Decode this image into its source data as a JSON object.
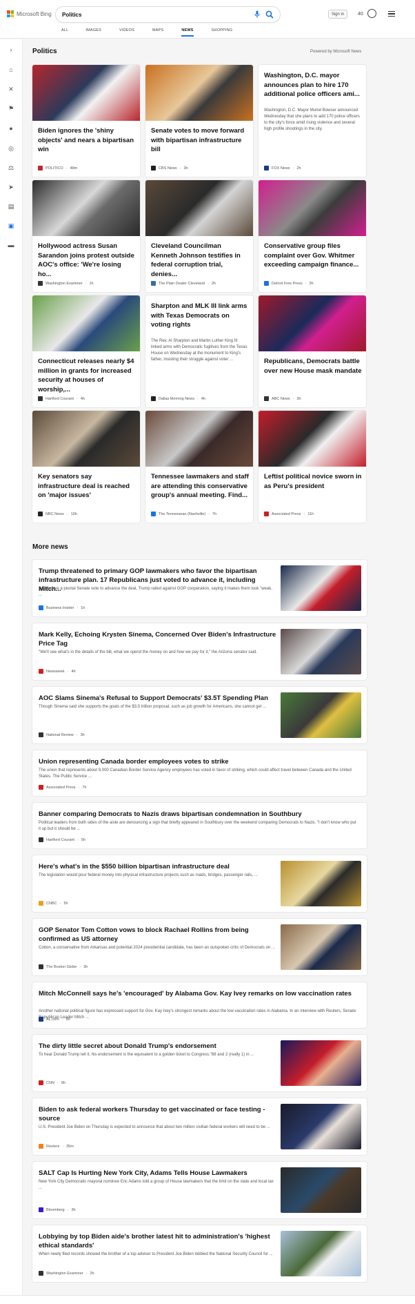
{
  "header": {
    "logo_text": "Microsoft Bing",
    "search_value": "Politics",
    "signin_label": "Sign in",
    "points": "40",
    "tabs": [
      "ALL",
      "IMAGES",
      "VIDEOS",
      "MAPS",
      "NEWS",
      "SHOPPING"
    ],
    "active_tab": "NEWS"
  },
  "rail_icons": [
    "chevron-right-icon",
    "home-icon",
    "tools-icon",
    "flag-icon",
    "location-icon",
    "globe-icon",
    "scales-icon",
    "rocket-icon",
    "film-icon",
    "bank-icon",
    "wallet-icon"
  ],
  "politics": {
    "title": "Politics",
    "powered_by": "Powered by Microsoft News",
    "cards": [
      {
        "title": "Biden ignores the 'shiny objects' and nears a bipartisan win",
        "source": "POLITICO",
        "time": "48m",
        "fav_color": "#c4262e",
        "img": [
          "#b7262d",
          "#f2f2f2",
          "#2c3a5a"
        ]
      },
      {
        "title": "Senate votes to move forward with bipartisan infrastructure bill",
        "source": "CBS News",
        "time": "3h",
        "fav_color": "#222222",
        "img": [
          "#c9711f",
          "#3a3a3a",
          "#e8c79a"
        ]
      },
      {
        "title": "Washington, D.C. mayor announces plan to hire 170 additional police officers ami...",
        "source": "FOX News",
        "time": "2h",
        "fav_color": "#1a3d7c",
        "snippet": "Washington, D.C. Mayor Muriel Bowser announced Wednesday that she plans to add 170 police officers to the city's force amid rising violence and several high profile shootings in the city.",
        "text_only": true
      },
      {
        "title": "Hollywood actress Susan Sarandon joins protest outside AOC's office: 'We're losing ho...",
        "source": "Washington Examiner",
        "time": "1h",
        "fav_color": "#333333",
        "img": [
          "#2a2a2a",
          "#6b6b6b",
          "#d8d8d8"
        ]
      },
      {
        "title": "Cleveland Councilman Kenneth Johnson testifies in federal corruption trial, denies...",
        "source": "The Plain Dealer Cleveland",
        "time": "2h",
        "fav_color": "#3a6ea5",
        "img": [
          "#5a4a3a",
          "#d4d4d4",
          "#2a2a2a"
        ]
      },
      {
        "title": "Conservative group files complaint over Gov. Whitmer exceeding campaign finance...",
        "source": "Detroit Free Press",
        "time": "3h",
        "fav_color": "#1a73e8",
        "img": [
          "#d11f8e",
          "#3c3c3c",
          "#8a8a8a"
        ]
      },
      {
        "title": "Connecticut releases nearly $4 million in grants for increased security at houses of worship,...",
        "source": "Hartford Courant",
        "time": "4h",
        "fav_color": "#333333",
        "img": [
          "#6aa04a",
          "#2a4a7a",
          "#e8e8e8"
        ]
      },
      {
        "title": "Sharpton and MLK III link arms with Texas Democrats on voting rights",
        "source": "Dallas Morning News",
        "time": "4h",
        "fav_color": "#222222",
        "snippet": "The Rev. Al Sharpton and Martin Luther King III linked arms with Democratic fugitives from the Texas House on Wednesday at the monument to King's father, insisting their struggle against voter ...",
        "text_only": true
      },
      {
        "title": "Republicans, Democrats battle over new House mask mandate",
        "source": "ABC News",
        "time": "3h",
        "fav_color": "#333333",
        "img": [
          "#a0192a",
          "#d11f8e",
          "#1a2a5a"
        ]
      },
      {
        "title": "Key senators say infrastructure deal is reached on 'major issues'",
        "source": "NBC News",
        "time": "10h",
        "fav_color": "#222222",
        "img": [
          "#5a4a3a",
          "#2a2a2a",
          "#c8b8a0"
        ]
      },
      {
        "title": "Tennessee lawmakers and staff are attending this conservative group's annual meeting. Find...",
        "source": "The Tennessean (Nashville)",
        "time": "7h",
        "fav_color": "#1a73e8",
        "img": [
          "#6a4a3a",
          "#3a2a2a",
          "#c8c8c8"
        ]
      },
      {
        "title": "Leftist political novice sworn in as Peru's president",
        "source": "Associated Press",
        "time": "11h",
        "fav_color": "#d11f1f",
        "img": [
          "#c41d2a",
          "#f0f0f0",
          "#2a2a2a"
        ]
      }
    ]
  },
  "more_news": {
    "title": "More news",
    "items": [
      {
        "title": "Trump threatened to primary GOP lawmakers who favor the bipartisan infrastructure plan. 17 Republicans just voted to advance it, including Mitch...",
        "snippet": "Just before a pivotal Senate vote to advance the deal, Trump railed against GOP cooperation, saying it makes them look \"weak, ...",
        "source": "Business Insider",
        "time": "1h",
        "fav_color": "#1a73e8",
        "img": [
          "#1a2a4a",
          "#c41d2a",
          "#e8e8e8"
        ]
      },
      {
        "title": "Mark Kelly, Echoing Krysten Sinema, Concerned Over Biden's Infrastructure Price Tag",
        "snippet": "\"We'll see what's in the details of the bill, what we spend the money on and how we pay for it,\" the Arizona senator said.",
        "source": "Newsweek",
        "time": "4h",
        "fav_color": "#d11f1f",
        "img": [
          "#5a4a4a",
          "#2a3a5a",
          "#d8d8d8"
        ]
      },
      {
        "title": "AOC Slams Sinema's Refusal to Support Democrats' $3.5T Spending Plan",
        "snippet": "Though Sinema said she supports the goals of the $3.5 trillion proposal, such as job growth for Americans, she cannot get ...",
        "source": "National Review",
        "time": "3h",
        "fav_color": "#333333",
        "img": [
          "#4a7a3a",
          "#e0c040",
          "#3a3a3a"
        ]
      },
      {
        "title": "Union representing Canada border employees votes to strike",
        "snippet": "The union that represents about 9,000 Canadian Border Service Agency employees has voted in favor of striking, which could affect travel between Canada and the United States. The Public Service ...",
        "source": "Associated Press",
        "time": "7h",
        "fav_color": "#d11f1f"
      },
      {
        "title": "Banner comparing Democrats to Nazis draws bipartisan condemnation in Southbury",
        "snippet": "Political leaders from both sides of the aisle are denouncing a sign that briefly appeared in Southbury over the weekend comparing Democrats to Nazis. \"I don't know who put it up but it should be ...",
        "source": "Hartford Courant",
        "time": "5h",
        "fav_color": "#333333"
      },
      {
        "title": "Here's what's in the $550 billion bipartisan infrastructure deal",
        "snippet": "The legislation would pour federal money into physical infrastructure projects such as roads, bridges, passenger rails, ...",
        "source": "CNBC",
        "time": "5h",
        "fav_color": "#e8a020",
        "img": [
          "#b89030",
          "#2a2a2a",
          "#e8d8a0"
        ]
      },
      {
        "title": "GOP Senator Tom Cotton vows to block Rachael Rollins from being confirmed as US attorney",
        "snippet": "Cotton, a conservative from Arkansas and potential 2024 presidential candidate, has been an outspoken critic of Democrats on ...",
        "source": "The Boston Globe",
        "time": "3h",
        "fav_color": "#333333",
        "img": [
          "#8a6a4a",
          "#1a2a4a",
          "#d8c8b0"
        ]
      },
      {
        "title": "Mitch McConnell says he's 'encouraged' by Alabama Gov. Kay Ivey remarks on low vaccination rates",
        "snippet": "Another national political figure has expressed support for Gov. Kay Ivey's strongest remarks about the low vaccination rates in Alabama. In an interview with Reuters, Senate Republican Leader Mitch ...",
        "source": "AL.com",
        "time": "5h",
        "fav_color": "#1a3d7c"
      },
      {
        "title": "The dirty little secret about Donald Trump's endorsement",
        "snippet": "To hear Donald Trump tell it, his endorsement is the equivalent to a golden ticket to Congress.\"88 and 2 (really 1) in ...",
        "source": "CNN",
        "time": "9h",
        "fav_color": "#d11f1f",
        "img": [
          "#1a1a5a",
          "#e8b090",
          "#c41d2a"
        ]
      },
      {
        "title": "Biden to ask federal workers Thursday to get vaccinated or face testing -source",
        "snippet": "U.S. President Joe Biden on Thursday is expected to announce that about two million civilian federal workers will need to be ...",
        "source": "Reuters",
        "time": "35m",
        "fav_color": "#f08020",
        "img": [
          "#1a1a2a",
          "#e8e0d8",
          "#2a3a6a"
        ]
      },
      {
        "title": "SALT Cap Is Hurting New York City, Adams Tells House Lawmakers",
        "snippet": "New York City Democratic mayoral nominee Eric Adams told a group of House lawmakers that the limit on the state and local tax ...",
        "source": "Bloomberg",
        "time": "3h",
        "fav_color": "#3a1ad1",
        "img": [
          "#2a2a2a",
          "#4a3a2a",
          "#2a4a6a"
        ]
      },
      {
        "title": "Lobbying by top Biden aide's brother latest hit to administration's 'highest ethical standards'",
        "snippet": "When newly filed records showed the brother of a top adviser to President Joe Biden lobbied the National Security Council for ...",
        "source": "Washington Examiner",
        "time": "2h",
        "fav_color": "#333333",
        "img": [
          "#a8c0d8",
          "#f0f0f0",
          "#4a6a3a"
        ]
      }
    ]
  }
}
